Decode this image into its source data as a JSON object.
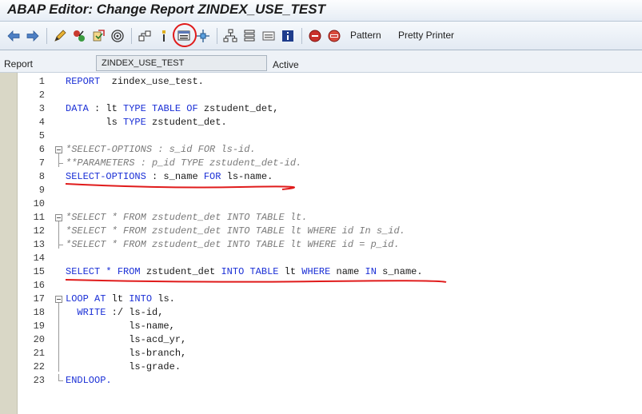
{
  "window": {
    "title": "ABAP Editor: Change Report ZINDEX_USE_TEST"
  },
  "toolbar": {
    "pattern_label": "Pattern",
    "pretty_printer_label": "Pretty Printer",
    "icons": [
      "back-icon",
      "forward-icon",
      "edit-toggle-icon",
      "check-icon",
      "activate-icon",
      "test-icon",
      "where-used-icon",
      "display-object-list-icon",
      "insert-statement-icon",
      "enhance-icon",
      "hierarchy-icon",
      "stack-icon",
      "module-icon",
      "info-icon",
      "breakpoint-icon",
      "session-breakpoint-icon"
    ],
    "accent_color": "#e01b1b"
  },
  "header": {
    "report_label": "Report",
    "report_name": "ZINDEX_USE_TEST",
    "status": "Active"
  },
  "editor": {
    "lines": [
      {
        "n": "1",
        "tokens": [
          {
            "t": "REPORT",
            "c": "kw"
          },
          {
            "t": "  zindex_use_test.",
            "c": ""
          }
        ]
      },
      {
        "n": "2",
        "tokens": []
      },
      {
        "n": "3",
        "tokens": [
          {
            "t": "DATA",
            "c": "kw"
          },
          {
            "t": " : lt ",
            "c": ""
          },
          {
            "t": "TYPE TABLE OF",
            "c": "kw"
          },
          {
            "t": " zstudent_det,",
            "c": ""
          }
        ]
      },
      {
        "n": "4",
        "tokens": [
          {
            "t": "       ls ",
            "c": ""
          },
          {
            "t": "TYPE",
            "c": "kw"
          },
          {
            "t": " zstudent_det.",
            "c": ""
          }
        ]
      },
      {
        "n": "5",
        "tokens": []
      },
      {
        "n": "6",
        "tokens": [
          {
            "t": "*SELECT-OPTIONS : s_id FOR ls-id.",
            "c": "cm"
          }
        ]
      },
      {
        "n": "7",
        "tokens": [
          {
            "t": "**PARAMETERS : p_id TYPE zstudent_det-id.",
            "c": "cm"
          }
        ]
      },
      {
        "n": "8",
        "tokens": [
          {
            "t": "SELECT-OPTIONS",
            "c": "kw"
          },
          {
            "t": " : s_name ",
            "c": ""
          },
          {
            "t": "FOR",
            "c": "kw"
          },
          {
            "t": " ls-name.",
            "c": ""
          }
        ]
      },
      {
        "n": "9",
        "tokens": []
      },
      {
        "n": "10",
        "tokens": []
      },
      {
        "n": "11",
        "tokens": [
          {
            "t": "*SELECT * FROM zstudent_det INTO TABLE lt.",
            "c": "cm"
          }
        ]
      },
      {
        "n": "12",
        "tokens": [
          {
            "t": "*SELECT * FROM zstudent_det INTO TABLE lt WHERE id In s_id.",
            "c": "cm"
          }
        ]
      },
      {
        "n": "13",
        "tokens": [
          {
            "t": "*SELECT * FROM zstudent_det INTO TABLE lt WHERE id = p_id.",
            "c": "cm"
          }
        ]
      },
      {
        "n": "14",
        "tokens": []
      },
      {
        "n": "15",
        "tokens": [
          {
            "t": "SELECT",
            "c": "kw"
          },
          {
            "t": " * ",
            "c": "kw"
          },
          {
            "t": "FROM",
            "c": "kw"
          },
          {
            "t": " zstudent_det ",
            "c": ""
          },
          {
            "t": "INTO TABLE",
            "c": "kw"
          },
          {
            "t": " lt ",
            "c": ""
          },
          {
            "t": "WHERE",
            "c": "kw"
          },
          {
            "t": " name ",
            "c": ""
          },
          {
            "t": "IN",
            "c": "kw"
          },
          {
            "t": " s_name.",
            "c": ""
          }
        ]
      },
      {
        "n": "16",
        "tokens": []
      },
      {
        "n": "17",
        "tokens": [
          {
            "t": "LOOP AT",
            "c": "kw"
          },
          {
            "t": " lt ",
            "c": ""
          },
          {
            "t": "INTO",
            "c": "kw"
          },
          {
            "t": " ls.",
            "c": ""
          }
        ]
      },
      {
        "n": "18",
        "tokens": [
          {
            "t": "  WRITE",
            "c": "kw"
          },
          {
            "t": " :/ ls-id,",
            "c": ""
          }
        ]
      },
      {
        "n": "19",
        "tokens": [
          {
            "t": "           ls-name,",
            "c": ""
          }
        ]
      },
      {
        "n": "20",
        "tokens": [
          {
            "t": "           ls-acd_yr,",
            "c": ""
          }
        ]
      },
      {
        "n": "21",
        "tokens": [
          {
            "t": "           ls-branch,",
            "c": ""
          }
        ]
      },
      {
        "n": "22",
        "tokens": [
          {
            "t": "           ls-grade.",
            "c": ""
          }
        ]
      },
      {
        "n": "23",
        "tokens": [
          {
            "t": "ENDLOOP.",
            "c": "kw"
          }
        ]
      }
    ]
  }
}
